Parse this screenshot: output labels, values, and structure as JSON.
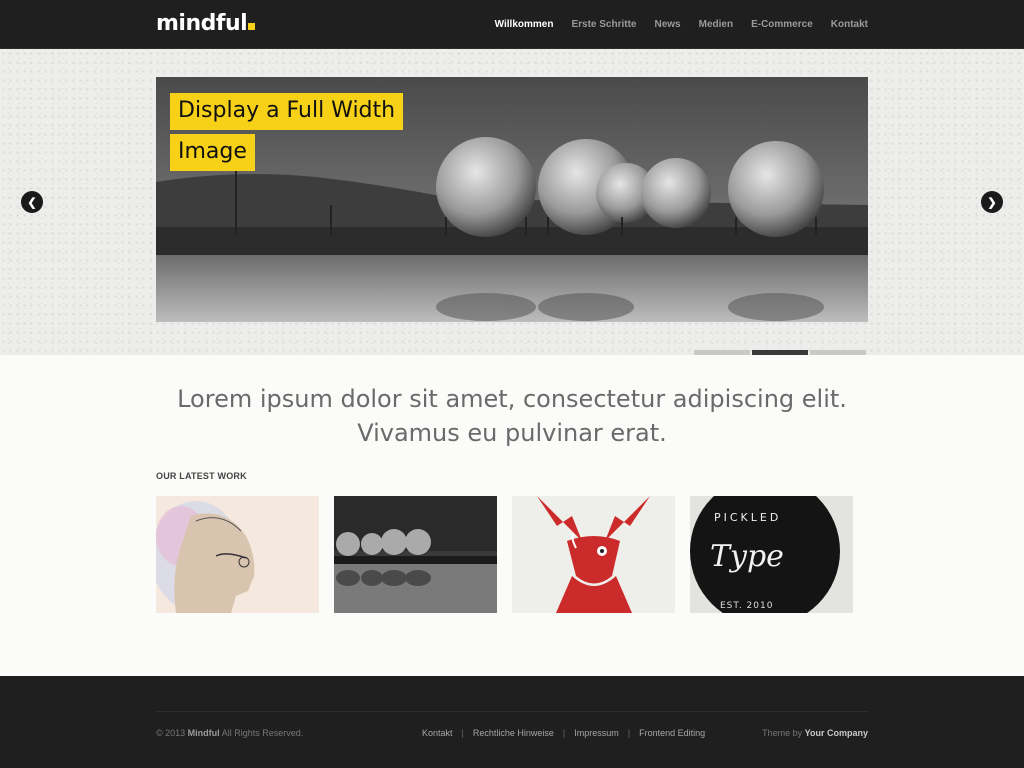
{
  "header": {
    "logo": "mindful",
    "nav": [
      "Willkommen",
      "Erste Schritte",
      "News",
      "Medien",
      "E-Commerce",
      "Kontakt"
    ],
    "active_nav": "Willkommen"
  },
  "slider": {
    "caption_line1": "Display a Full Width",
    "caption_line2": "Image",
    "prev_icon": "chevron-left",
    "next_icon": "chevron-right",
    "pager_count": 3,
    "active_slide": 2
  },
  "intro": {
    "line1": "Lorem ipsum dolor sit amet, consectetur adipiscing elit.",
    "line2": "Vivamus eu pulvinar erat."
  },
  "latest_work": {
    "title": "OUR LATEST WORK",
    "items": [
      "portrait illustration",
      "gas tanks photo",
      "red deer illustration",
      "pickled type badge"
    ]
  },
  "footer": {
    "copyright_prefix": "© 2013",
    "brand": "Mindful",
    "copyright_suffix": "All Rights Reserved.",
    "links": [
      "Kontakt",
      "Rechtliche Hinweise",
      "Impressum",
      "Frontend Editing"
    ],
    "separator": "|",
    "theme_prefix": "Theme by",
    "theme_company": "Your Company"
  },
  "colors": {
    "accent": "#f7d117",
    "header_bg": "#1f1f1f",
    "footer_bg": "#1f1f1f",
    "page_bg": "#fbfbf9"
  }
}
